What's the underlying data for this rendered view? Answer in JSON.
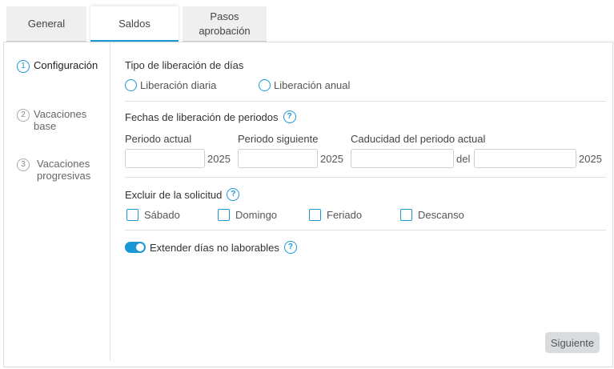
{
  "tabs": [
    {
      "label": "General"
    },
    {
      "label": "Saldos"
    },
    {
      "label": "Pasos aprobación"
    }
  ],
  "steps": [
    {
      "num": "1",
      "label": "Configuración"
    },
    {
      "num": "2",
      "label": "Vacaciones base"
    },
    {
      "num": "3",
      "label": "Vacaciones progresivas"
    }
  ],
  "release_type": {
    "title": "Tipo de liberación de días",
    "options": [
      {
        "label": "Liberación diaria"
      },
      {
        "label": "Liberación anual"
      }
    ]
  },
  "periods": {
    "title": "Fechas de liberación de periodos",
    "current_label": "Periodo actual",
    "current_year": "2025",
    "next_label": "Periodo siguiente",
    "next_year": "2025",
    "expiry_label": "Caducidad del periodo actual",
    "expiry_del": "del",
    "expiry_year": "2025",
    "current_value": "",
    "next_value": "",
    "expiry_value": "",
    "expiry_value2": ""
  },
  "exclude": {
    "title": "Excluir de la solicitud",
    "options": [
      {
        "label": "Sábado"
      },
      {
        "label": "Domingo"
      },
      {
        "label": "Feriado"
      },
      {
        "label": "Descanso"
      }
    ]
  },
  "extend": {
    "label": "Extender días no laborables",
    "enabled": true
  },
  "actions": {
    "next_label": "Siguiente"
  },
  "colors": {
    "accent": "#1a98d5",
    "button_bg": "#d9dcdf"
  }
}
